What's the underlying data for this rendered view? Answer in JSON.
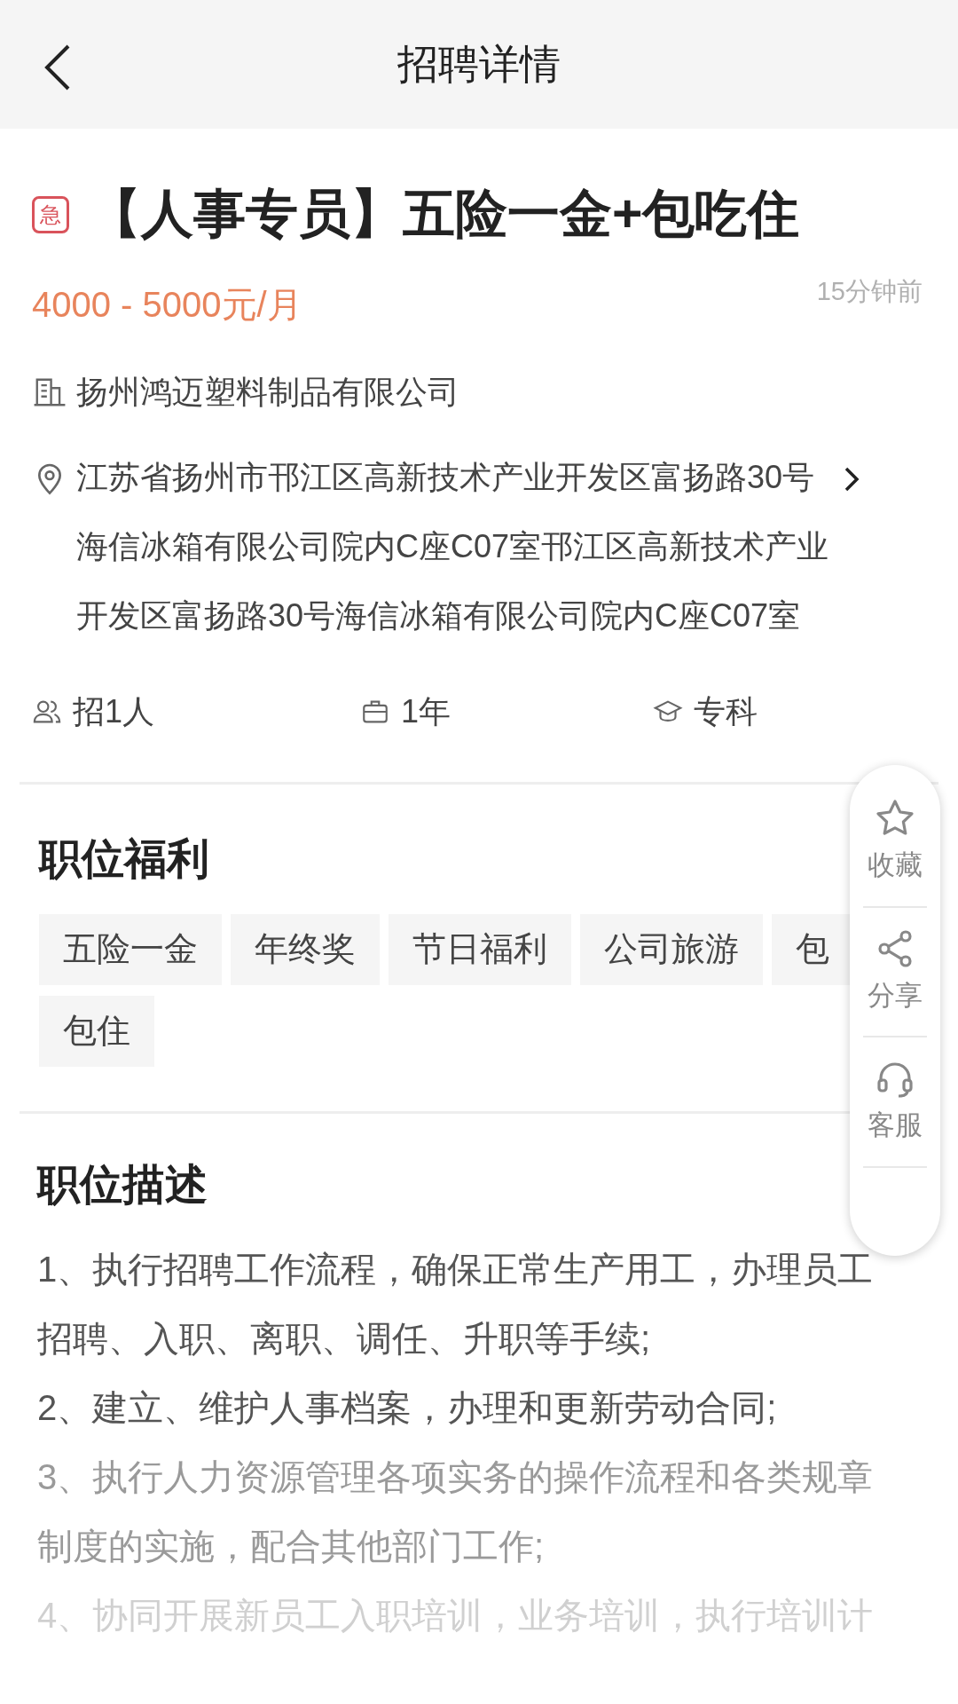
{
  "header": {
    "title": "招聘详情"
  },
  "job": {
    "title": "【人事专员】五险一金+包吃住",
    "urgent_badge": "急",
    "salary": "4000 - 5000元/月",
    "posted": "15分钟前",
    "company": "扬州鸿迈塑料制品有限公司",
    "address": "江苏省扬州市邗江区高新技术产业开发区富扬路30号海信冰箱有限公司院内C座C07室邗江区高新技术产业开发区富扬路30号海信冰箱有限公司院内C座C07室"
  },
  "stats": [
    {
      "kind": "people",
      "text": "招1人"
    },
    {
      "kind": "experience",
      "text": "1年"
    },
    {
      "kind": "education",
      "text": "专科"
    }
  ],
  "benefits": {
    "title": "职位福利",
    "tags": [
      "五险一金",
      "年终奖",
      "节日福利",
      "公司旅游",
      "包",
      "包住"
    ]
  },
  "description": {
    "title": "职位描述",
    "items": [
      "1、执行招聘工作流程，确保正常生产用工，办理员工招聘、入职、离职、调任、升职等手续;",
      "2、建立、维护人事档案，办理和更新劳动合同;",
      "3、执行人力资源管理各项实务的操作流程和各类规章制度的实施，配合其他部门工作;",
      "4、协同开展新员工入职培训，业务培训，执行培训计"
    ]
  },
  "float_menu": [
    {
      "kind": "star",
      "label": "收藏"
    },
    {
      "kind": "share",
      "label": "分享"
    },
    {
      "kind": "headset",
      "label": "客服"
    }
  ]
}
